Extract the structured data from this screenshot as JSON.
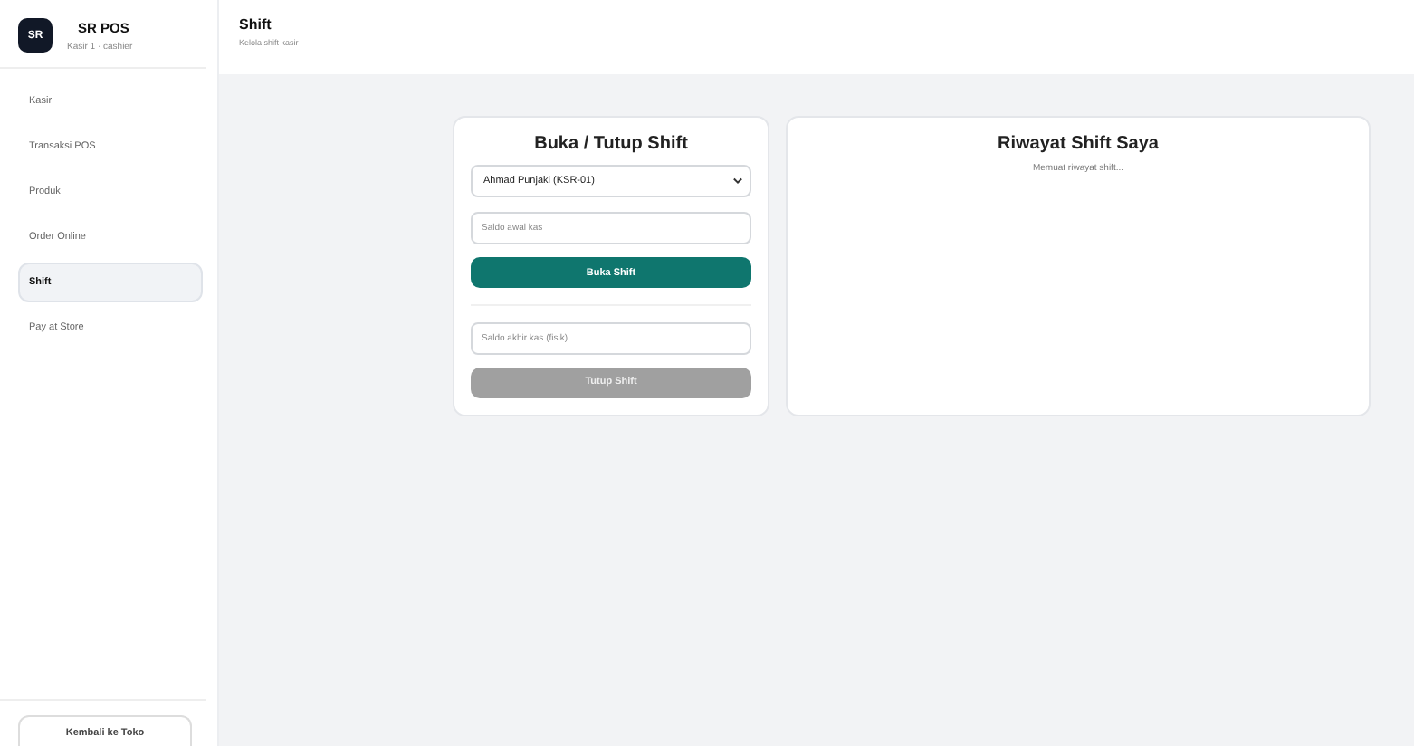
{
  "brand": {
    "logo": "SR",
    "name": "SR POS",
    "subtitle": "Kasir 1 · cashier"
  },
  "header": {
    "title": "Shift",
    "subtitle": "Kelola shift kasir"
  },
  "sidebar": {
    "items": [
      {
        "label": "Kasir",
        "selected": false
      },
      {
        "label": "Transaksi POS",
        "selected": false
      },
      {
        "label": "Produk",
        "selected": false
      },
      {
        "label": "Order Online",
        "selected": false
      },
      {
        "label": "Shift",
        "selected": true
      },
      {
        "label": "Pay at Store",
        "selected": false
      }
    ],
    "footer_button": "Kembali ke Toko"
  },
  "shift_card": {
    "title": "Buka / Tutup Shift",
    "cashier_select": "Ahmad Punjaki (KSR-01)",
    "open_field": {
      "placeholder": "Saldo awal kas"
    },
    "open_button": {
      "label": "Buka Shift",
      "disabled": false
    },
    "close_field": {
      "placeholder": "Saldo akhir kas (fisik)"
    },
    "close_button": {
      "label": "Tutup Shift",
      "disabled": true
    }
  },
  "history_card": {
    "title": "Riwayat Shift Saya",
    "status": "Memuat riwayat shift..."
  }
}
